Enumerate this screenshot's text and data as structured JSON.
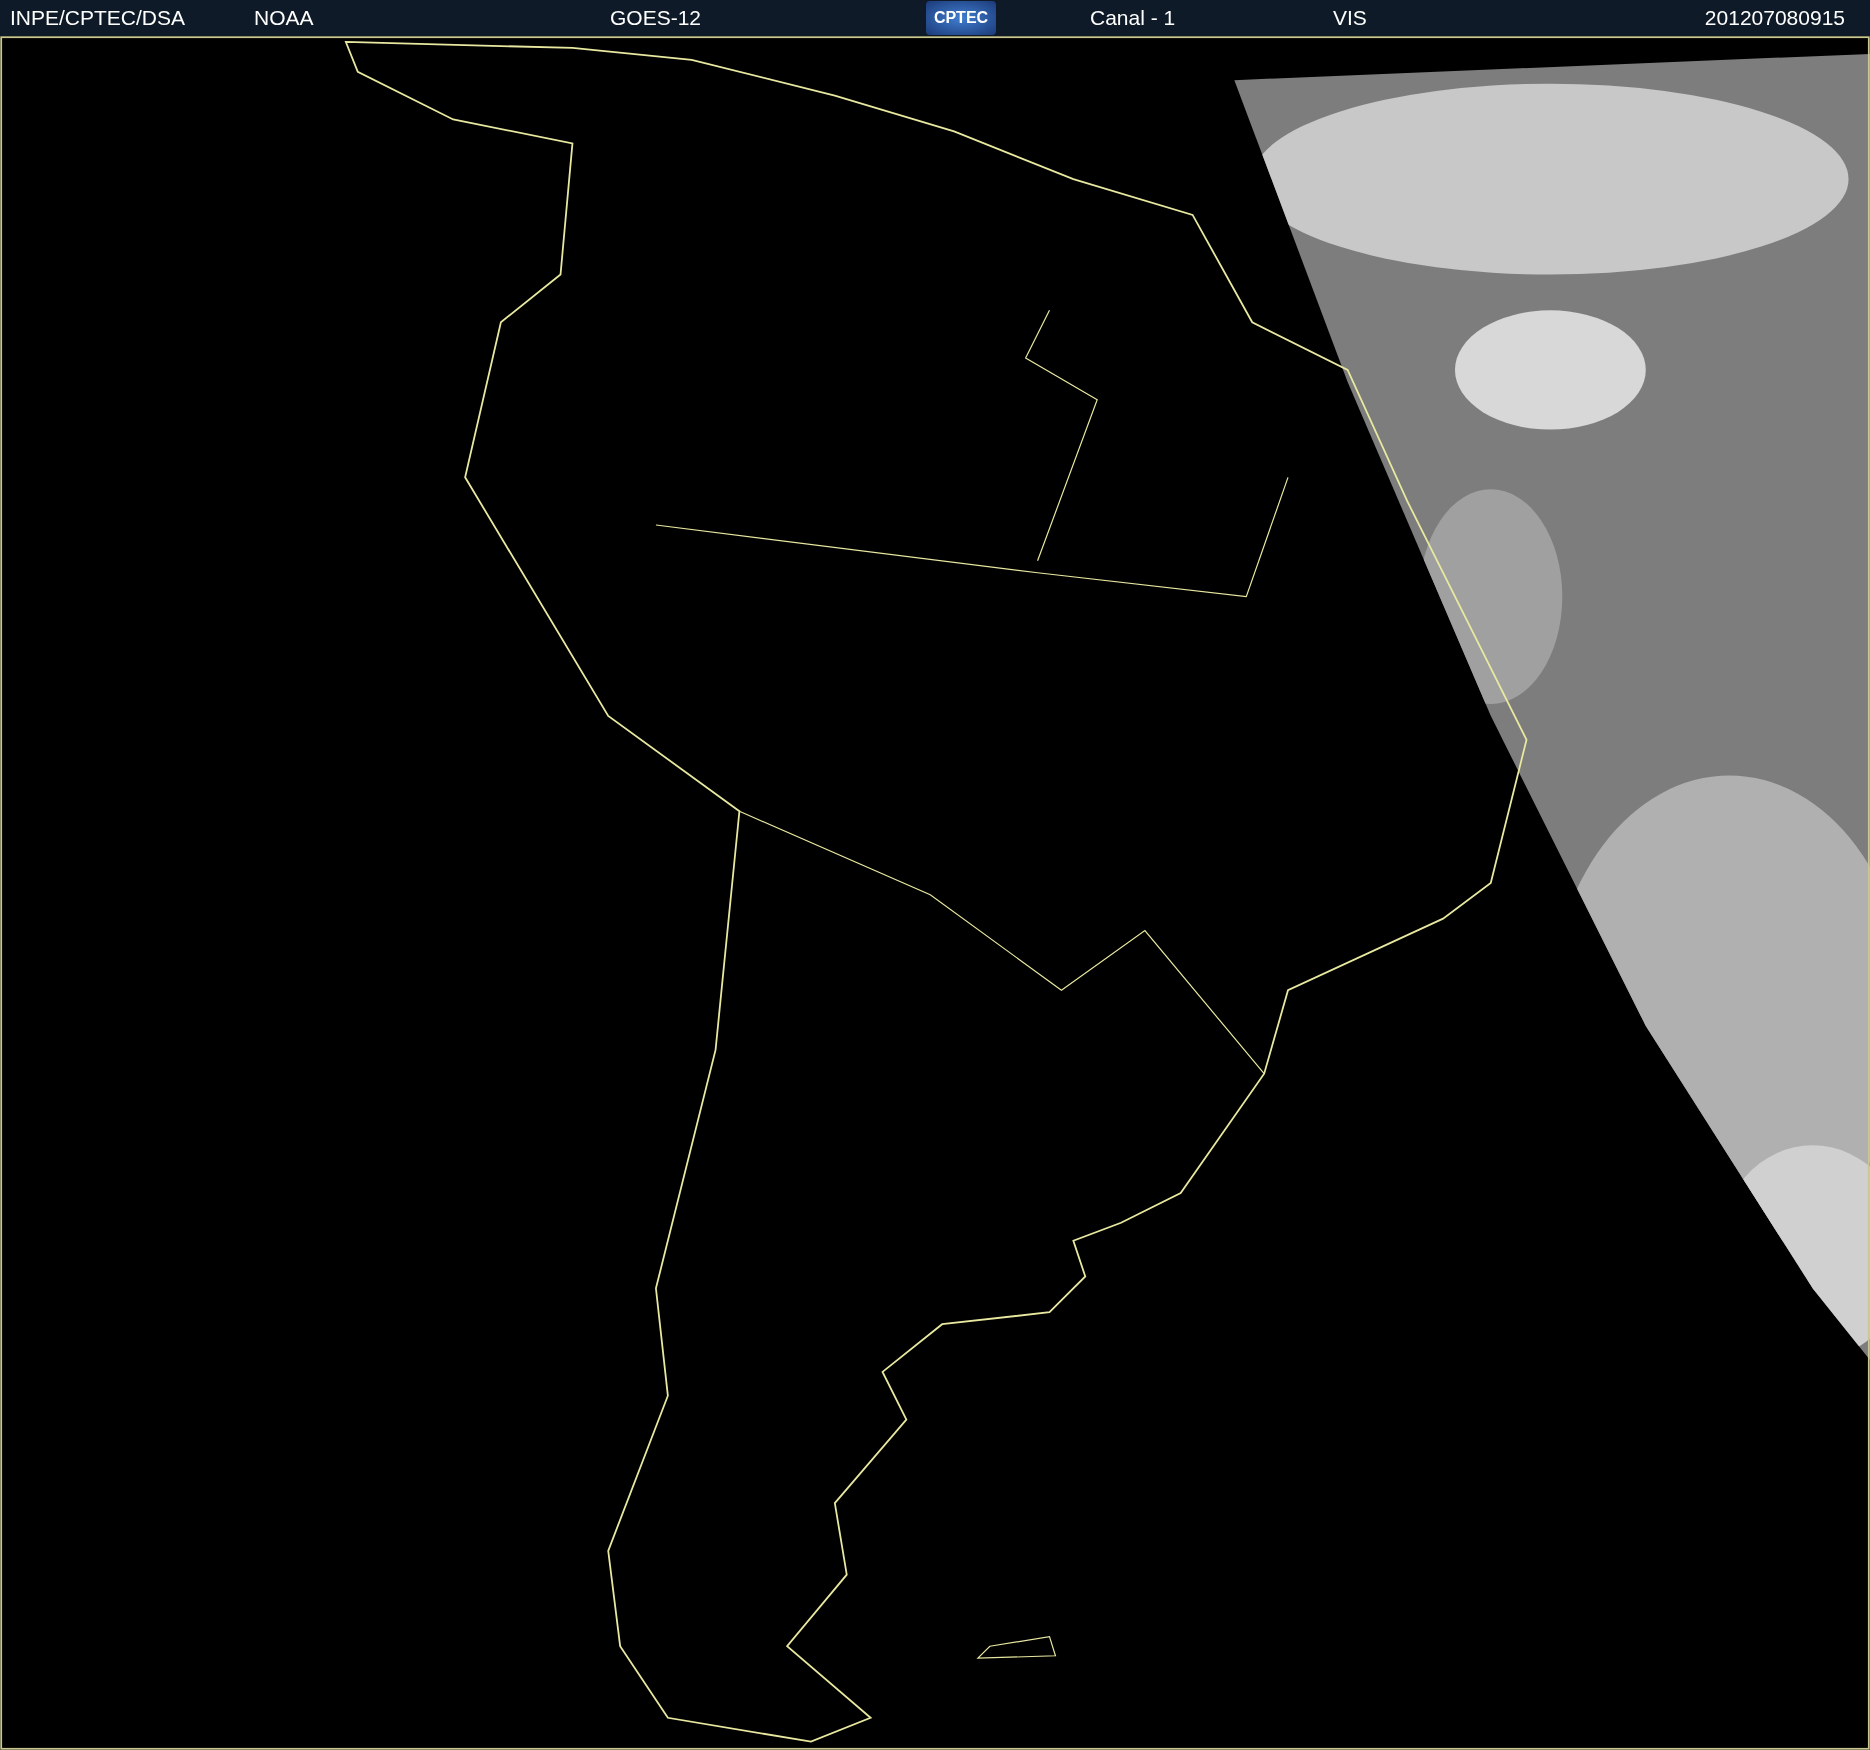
{
  "header": {
    "source": "INPE/CPTEC/DSA",
    "agency": "NOAA",
    "satellite": "GOES-12",
    "logo": "CPTEC",
    "channel": "Canal - 1",
    "band": "VIS",
    "timestamp": "201207080915"
  }
}
